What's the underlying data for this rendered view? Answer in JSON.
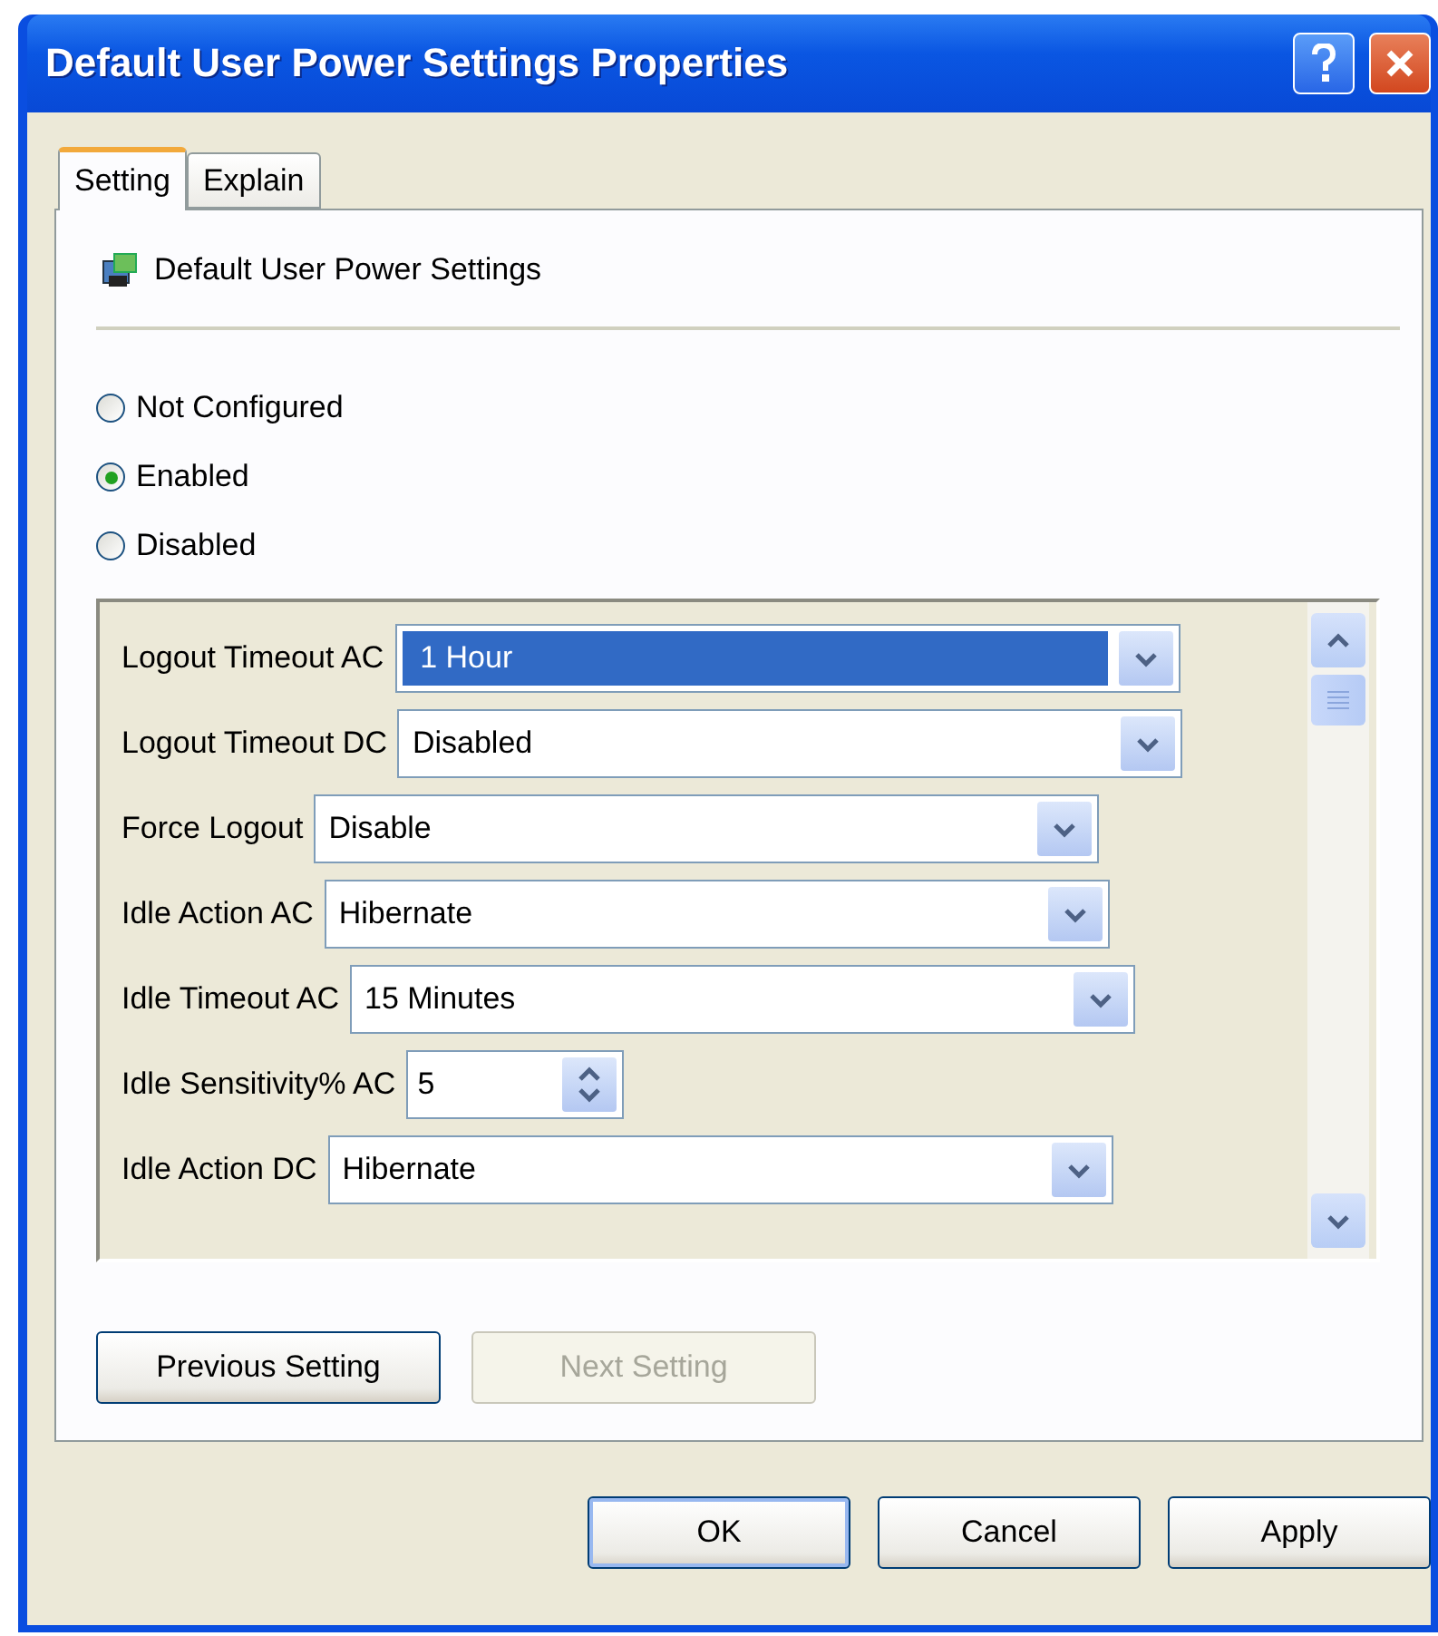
{
  "window": {
    "title": "Default User Power Settings Properties"
  },
  "tabs": [
    {
      "label": "Setting",
      "selected": true
    },
    {
      "label": "Explain",
      "selected": false
    }
  ],
  "policy": {
    "name": "Default User Power Settings"
  },
  "options": [
    {
      "label": "Not Configured",
      "selected": false
    },
    {
      "label": "Enabled",
      "selected": true
    },
    {
      "label": "Disabled",
      "selected": false
    }
  ],
  "settings": [
    {
      "kind": "dropdown",
      "label": "Logout Timeout AC",
      "value": "1 Hour",
      "focused": true
    },
    {
      "kind": "dropdown",
      "label": "Logout Timeout DC",
      "value": "Disabled",
      "focused": false
    },
    {
      "kind": "dropdown",
      "label": "Force Logout",
      "value": "Disable",
      "focused": false
    },
    {
      "kind": "dropdown",
      "label": "Idle Action AC",
      "value": "Hibernate",
      "focused": false
    },
    {
      "kind": "dropdown",
      "label": "Idle Timeout AC",
      "value": "15 Minutes",
      "focused": false
    },
    {
      "kind": "spinner",
      "label": "Idle Sensitivity% AC",
      "value": "5",
      "focused": false
    },
    {
      "kind": "dropdown",
      "label": "Idle Action DC",
      "value": "Hibernate",
      "focused": false
    }
  ],
  "nav_buttons": [
    {
      "label": "Previous Setting",
      "disabled": false
    },
    {
      "label": "Next Setting",
      "disabled": true
    }
  ],
  "buttons": [
    {
      "label": "OK",
      "default": true
    },
    {
      "label": "Cancel",
      "default": false
    },
    {
      "label": "Apply",
      "default": false
    }
  ]
}
